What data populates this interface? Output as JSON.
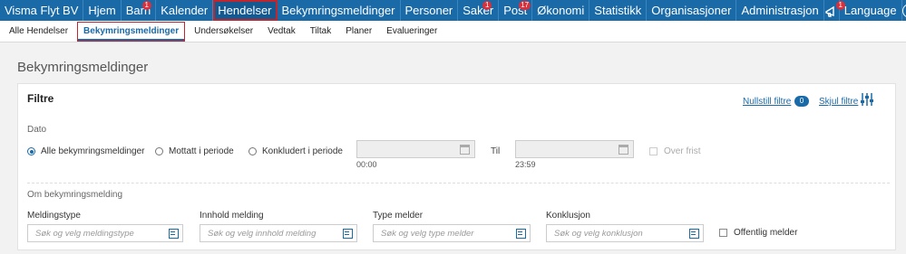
{
  "topnav": {
    "brand": "Visma Flyt BV",
    "items": [
      {
        "label": "Hjem"
      },
      {
        "label": "Barn",
        "badge": "1"
      },
      {
        "label": "Kalender"
      },
      {
        "label": "Hendelser",
        "active": true
      },
      {
        "label": "Bekymringsmeldinger"
      },
      {
        "label": "Personer"
      },
      {
        "label": "Saker",
        "badge": "1"
      },
      {
        "label": "Post",
        "badge": "17"
      },
      {
        "label": "Økonomi"
      },
      {
        "label": "Statistikk"
      },
      {
        "label": "Organisasjoner"
      },
      {
        "label": "Administrasjon"
      }
    ],
    "notification_badge": "1",
    "language": "Language",
    "help": "?"
  },
  "subnav": {
    "items": [
      {
        "label": "Alle Hendelser"
      },
      {
        "label": "Bekymringsmeldinger",
        "active": true
      },
      {
        "label": "Undersøkelser"
      },
      {
        "label": "Vedtak"
      },
      {
        "label": "Tiltak"
      },
      {
        "label": "Planer"
      },
      {
        "label": "Evalueringer"
      }
    ]
  },
  "page_title": "Bekymringsmeldinger",
  "filters": {
    "title": "Filtre",
    "reset_label": "Nullstill filtre",
    "reset_count": "0",
    "hide_label": "Skjul filtre",
    "date": {
      "label": "Dato",
      "options": [
        "Alle bekymringsmeldinger",
        "Mottatt i periode",
        "Konkludert i periode"
      ],
      "selected": "Alle bekymringsmeldinger",
      "from_time": "00:00",
      "to_label": "Til",
      "to_time": "23:59",
      "overdue_label": "Over frist"
    },
    "about": {
      "label": "Om bekymringsmelding",
      "fields": [
        {
          "label": "Meldingstype",
          "placeholder": "Søk og velg meldingstype"
        },
        {
          "label": "Innhold melding",
          "placeholder": "Søk og velg innhold melding"
        },
        {
          "label": "Type melder",
          "placeholder": "Søk og velg type melder"
        },
        {
          "label": "Konklusjon",
          "placeholder": "Søk og velg konklusjon"
        }
      ],
      "public_reporter_label": "Offentlig melder"
    }
  },
  "colors": {
    "nav_bg": "#1a6aa8",
    "accent": "#1a6aa8",
    "active_outline": "#c0262e",
    "badge": "#d9303b"
  }
}
